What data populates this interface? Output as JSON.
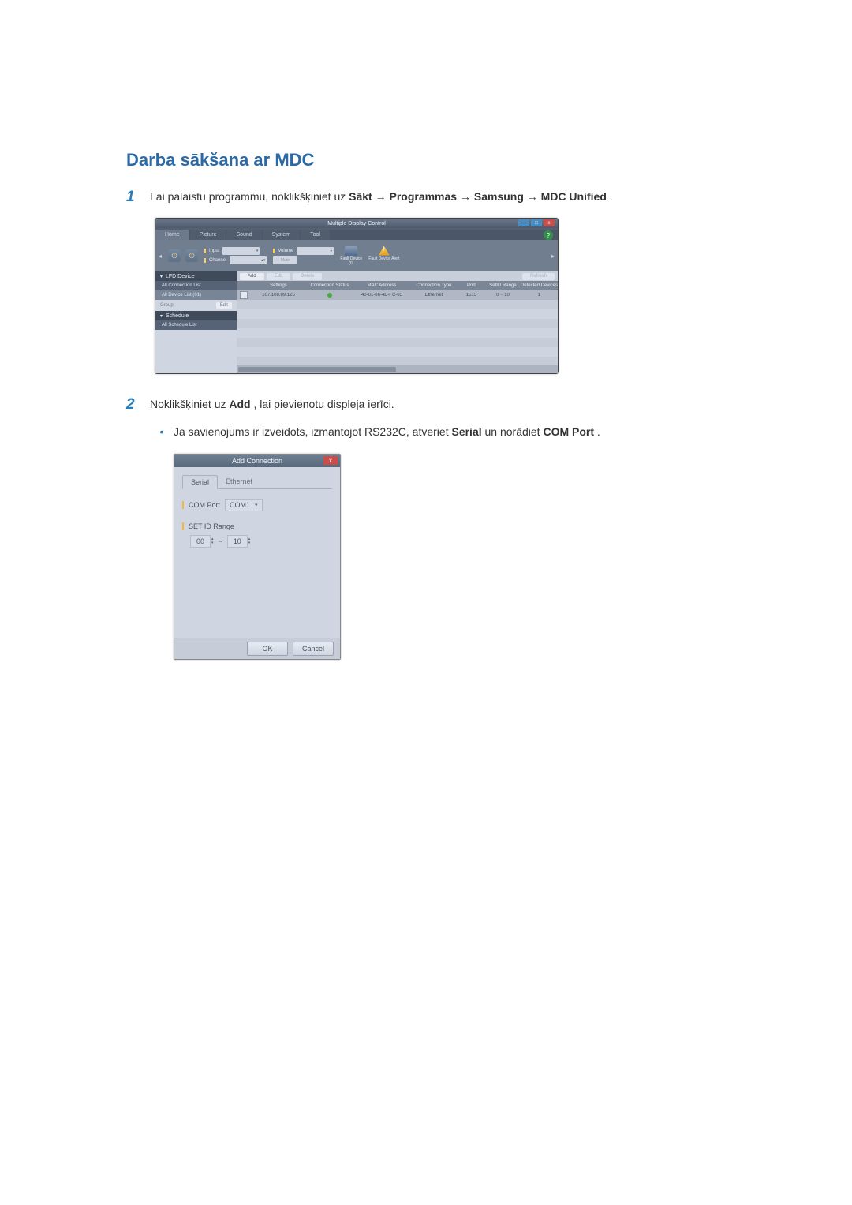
{
  "heading": "Darba sākšana ar MDC",
  "step1": {
    "num": "1",
    "pre": "Lai palaistu programmu, noklikšķiniet uz ",
    "b1": "Sākt",
    "a1": " → ",
    "b2": "Programmas",
    "a2": " → ",
    "b3": "Samsung",
    "a3": " → ",
    "b4": "MDC Unified",
    "post": "."
  },
  "step2": {
    "num": "2",
    "pre": "Noklikšķiniet uz ",
    "b1": "Add",
    "post": ", lai pievienotu displeja ierīci."
  },
  "bullet": {
    "dot": "•",
    "pre": "Ja savienojums ir izveidots, izmantojot RS232C, atveriet ",
    "b1": "Serial",
    "mid": " un norādiet ",
    "b2": "COM Port",
    "post": "."
  },
  "mdc": {
    "title": "Multiple Display Control",
    "help": "?",
    "win": {
      "min": "–",
      "max": "□",
      "close": "x"
    },
    "menu": {
      "home": "Home",
      "picture": "Picture",
      "sound": "Sound",
      "system": "System",
      "tool": "Tool"
    },
    "ribbon": {
      "left": "◂",
      "right": "▸",
      "input_label": "Input",
      "channel_label": "Channel",
      "volume_label": "Volume",
      "mute_label": "Mute",
      "fault_device": "Fault Device",
      "fault_count": "(0)",
      "fault_alert": "Fault Device\nAlert"
    },
    "side": {
      "lfd": "LFD Device",
      "all_conn": "All Connection List",
      "all_device": "All Device List (01)",
      "group": "Group",
      "edit": "Edit",
      "schedule": "Schedule",
      "all_sched": "All Schedule List"
    },
    "toolbar": {
      "add": "Add",
      "edit": "Edit",
      "delete": "Delete",
      "refresh": "Refresh"
    },
    "cols": {
      "settings": "Settings",
      "conn_status": "Connection Status",
      "mac": "MAC Address",
      "ctype": "Connection Type",
      "port": "Port",
      "range": "SetID Range",
      "detected": "Detected Devices"
    },
    "row": {
      "ip": "107.108.89.126",
      "mac": "40-61-86-4E-FC-65",
      "ctype": "Ethernet",
      "port": "1515",
      "range": "0 ~ 10",
      "detected": "1"
    }
  },
  "dlg": {
    "title": "Add Connection",
    "close": "x",
    "tab_serial": "Serial",
    "tab_eth": "Ethernet",
    "com_port_label": "COM Port",
    "com_port_value": "COM1",
    "range_label": "SET ID Range",
    "range_from": "00",
    "range_dash": "~",
    "range_to": "10",
    "ok": "OK",
    "cancel": "Cancel"
  }
}
